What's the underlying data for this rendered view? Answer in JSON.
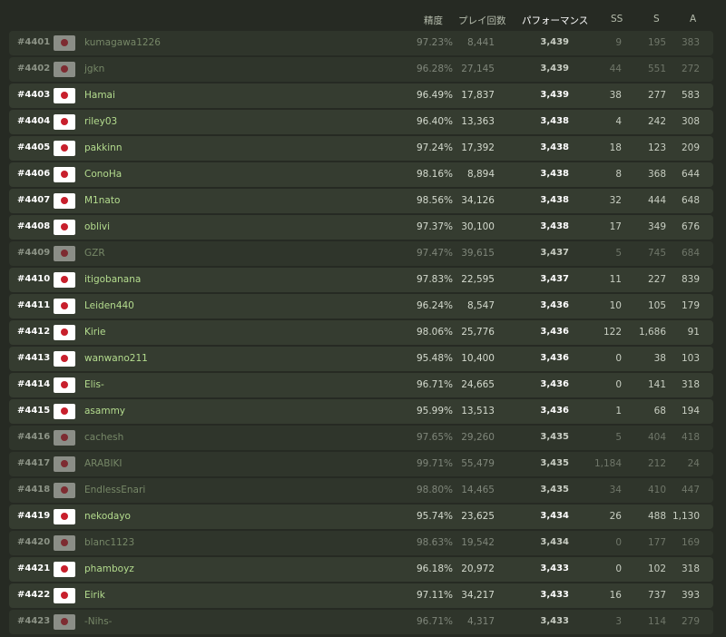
{
  "headers": {
    "accuracy": "精度",
    "play_count": "プレイ回数",
    "performance": "パフォーマンス",
    "ss": "SS",
    "s": "S",
    "a": "A"
  },
  "flag_icon": "japan-flag-icon",
  "rows": [
    {
      "rank": "#4401",
      "user": "kumagawa1226",
      "acc": "97.23%",
      "plays": "8,441",
      "pp": "3,439",
      "ss": "9",
      "s": "195",
      "a": "383",
      "active": false
    },
    {
      "rank": "#4402",
      "user": "jgkn",
      "acc": "96.28%",
      "plays": "27,145",
      "pp": "3,439",
      "ss": "44",
      "s": "551",
      "a": "272",
      "active": false
    },
    {
      "rank": "#4403",
      "user": "Hamai",
      "acc": "96.49%",
      "plays": "17,837",
      "pp": "3,439",
      "ss": "38",
      "s": "277",
      "a": "583",
      "active": true
    },
    {
      "rank": "#4404",
      "user": "riley03",
      "acc": "96.40%",
      "plays": "13,363",
      "pp": "3,438",
      "ss": "4",
      "s": "242",
      "a": "308",
      "active": true
    },
    {
      "rank": "#4405",
      "user": "pakkinn",
      "acc": "97.24%",
      "plays": "17,392",
      "pp": "3,438",
      "ss": "18",
      "s": "123",
      "a": "209",
      "active": true
    },
    {
      "rank": "#4406",
      "user": "ConoHa",
      "acc": "98.16%",
      "plays": "8,894",
      "pp": "3,438",
      "ss": "8",
      "s": "368",
      "a": "644",
      "active": true
    },
    {
      "rank": "#4407",
      "user": "M1nato",
      "acc": "98.56%",
      "plays": "34,126",
      "pp": "3,438",
      "ss": "32",
      "s": "444",
      "a": "648",
      "active": true
    },
    {
      "rank": "#4408",
      "user": "oblivi",
      "acc": "97.37%",
      "plays": "30,100",
      "pp": "3,438",
      "ss": "17",
      "s": "349",
      "a": "676",
      "active": true
    },
    {
      "rank": "#4409",
      "user": "GZR",
      "acc": "97.47%",
      "plays": "39,615",
      "pp": "3,437",
      "ss": "5",
      "s": "745",
      "a": "684",
      "active": false
    },
    {
      "rank": "#4410",
      "user": "itigobanana",
      "acc": "97.83%",
      "plays": "22,595",
      "pp": "3,437",
      "ss": "11",
      "s": "227",
      "a": "839",
      "active": true
    },
    {
      "rank": "#4411",
      "user": "Leiden440",
      "acc": "96.24%",
      "plays": "8,547",
      "pp": "3,436",
      "ss": "10",
      "s": "105",
      "a": "179",
      "active": true
    },
    {
      "rank": "#4412",
      "user": "Kirie",
      "acc": "98.06%",
      "plays": "25,776",
      "pp": "3,436",
      "ss": "122",
      "s": "1,686",
      "a": "91",
      "active": true
    },
    {
      "rank": "#4413",
      "user": "wanwano211",
      "acc": "95.48%",
      "plays": "10,400",
      "pp": "3,436",
      "ss": "0",
      "s": "38",
      "a": "103",
      "active": true
    },
    {
      "rank": "#4414",
      "user": "Elis-",
      "acc": "96.71%",
      "plays": "24,665",
      "pp": "3,436",
      "ss": "0",
      "s": "141",
      "a": "318",
      "active": true
    },
    {
      "rank": "#4415",
      "user": "asammy",
      "acc": "95.99%",
      "plays": "13,513",
      "pp": "3,436",
      "ss": "1",
      "s": "68",
      "a": "194",
      "active": true
    },
    {
      "rank": "#4416",
      "user": "cachesh",
      "acc": "97.65%",
      "plays": "29,260",
      "pp": "3,435",
      "ss": "5",
      "s": "404",
      "a": "418",
      "active": false
    },
    {
      "rank": "#4417",
      "user": "ARABIKI",
      "acc": "99.71%",
      "plays": "55,479",
      "pp": "3,435",
      "ss": "1,184",
      "s": "212",
      "a": "24",
      "active": false
    },
    {
      "rank": "#4418",
      "user": "EndlessEnari",
      "acc": "98.80%",
      "plays": "14,465",
      "pp": "3,435",
      "ss": "34",
      "s": "410",
      "a": "447",
      "active": false
    },
    {
      "rank": "#4419",
      "user": "nekodayo",
      "acc": "95.74%",
      "plays": "23,625",
      "pp": "3,434",
      "ss": "26",
      "s": "488",
      "a": "1,130",
      "active": true
    },
    {
      "rank": "#4420",
      "user": "blanc1123",
      "acc": "98.63%",
      "plays": "19,542",
      "pp": "3,434",
      "ss": "0",
      "s": "177",
      "a": "169",
      "active": false
    },
    {
      "rank": "#4421",
      "user": "phamboyz",
      "acc": "96.18%",
      "plays": "20,972",
      "pp": "3,433",
      "ss": "0",
      "s": "102",
      "a": "318",
      "active": true
    },
    {
      "rank": "#4422",
      "user": "Eirik",
      "acc": "97.11%",
      "plays": "34,217",
      "pp": "3,433",
      "ss": "16",
      "s": "737",
      "a": "393",
      "active": true
    },
    {
      "rank": "#4423",
      "user": "-Nihs-",
      "acc": "96.71%",
      "plays": "4,317",
      "pp": "3,433",
      "ss": "3",
      "s": "114",
      "a": "279",
      "active": false
    }
  ]
}
